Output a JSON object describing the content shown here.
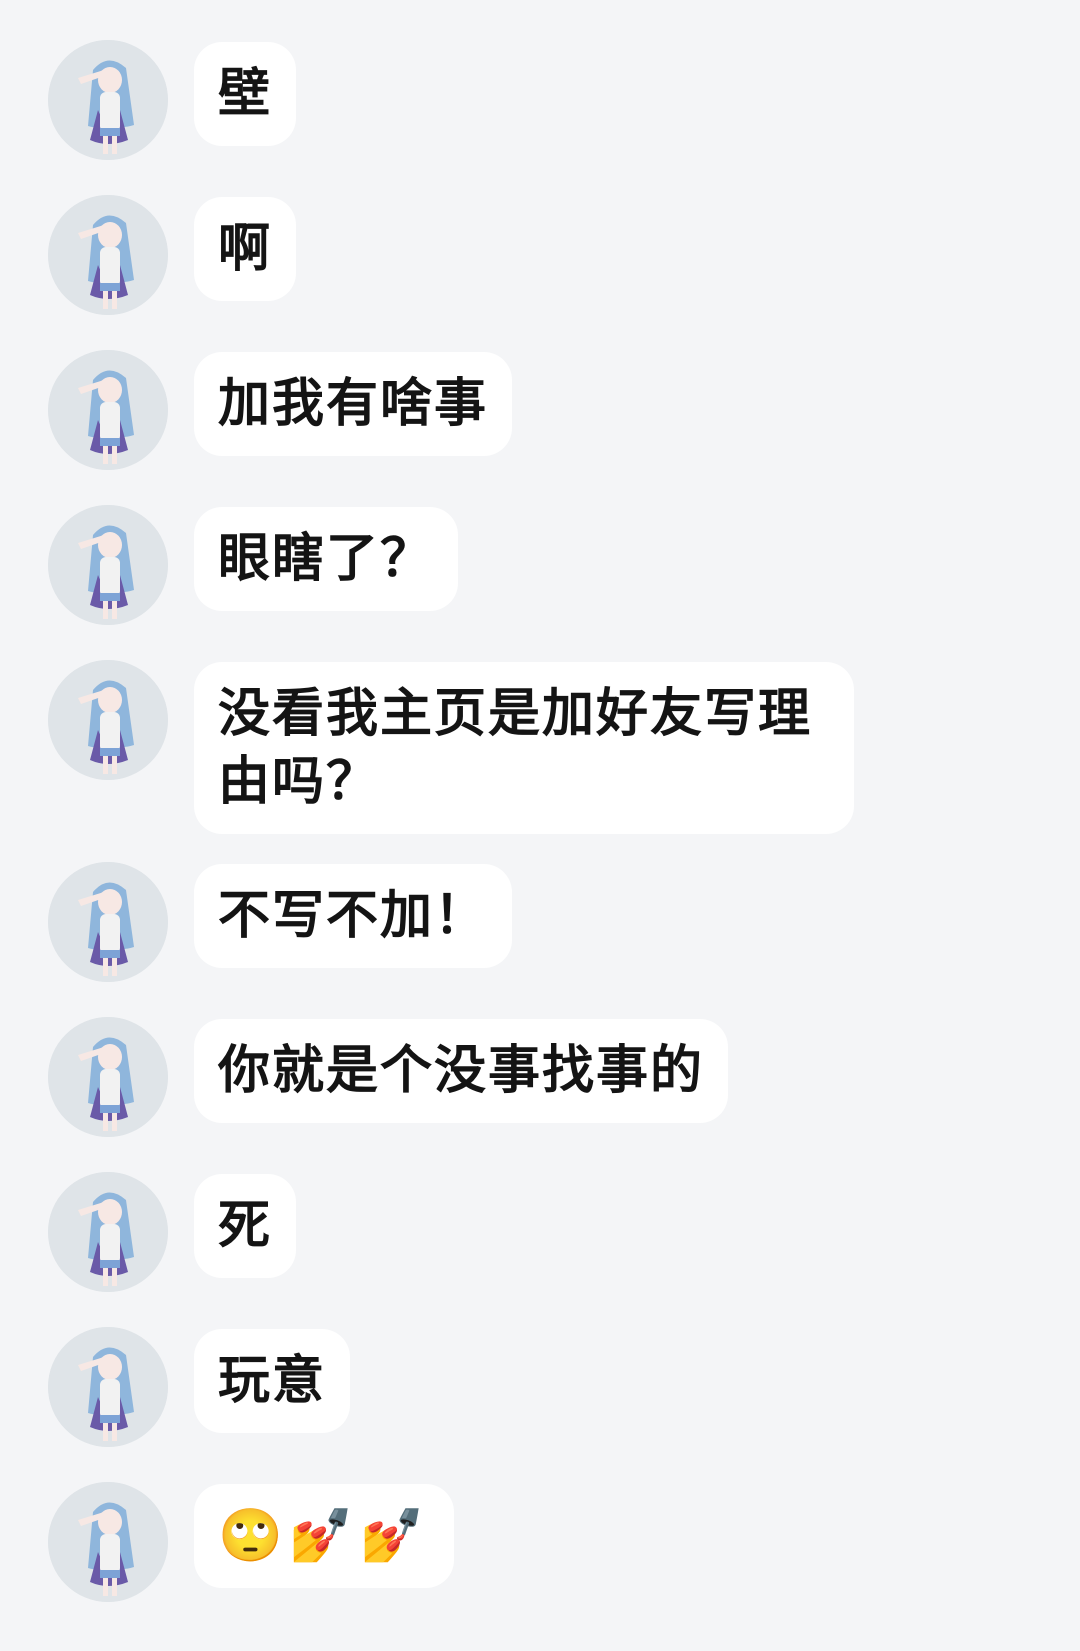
{
  "chat": {
    "messages": [
      {
        "text": "壁"
      },
      {
        "text": "啊"
      },
      {
        "text": "加我有啥事"
      },
      {
        "text": "眼瞎了？"
      },
      {
        "text": "没看我主页是加好友写理由吗？"
      },
      {
        "text": "不写不加！"
      },
      {
        "text": "你就是个没事找事的"
      },
      {
        "text": "死"
      },
      {
        "text": "玩意"
      },
      {
        "text": "🙄💅💅"
      }
    ]
  },
  "colors": {
    "background": "#f4f5f7",
    "bubble": "#ffffff",
    "text": "#141414",
    "avatar_bg": "#dfe4e8"
  },
  "icons": {
    "avatar": "anime-girl-avatar-icon"
  }
}
